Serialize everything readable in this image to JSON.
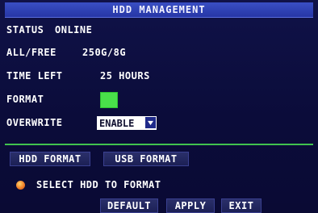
{
  "title": "HDD MANAGEMENT",
  "fields": {
    "status_label": "STATUS",
    "status_value": "ONLINE",
    "capacity_label": "ALL/FREE",
    "capacity_value": "250G/8G",
    "time_left_label": "TIME LEFT",
    "time_left_value": "25 HOURS",
    "format_label": "FORMAT",
    "overwrite_label": "OVERWRITE",
    "overwrite_value": "ENABLE"
  },
  "buttons": {
    "hdd_format": "HDD FORMAT",
    "usb_format": "USB FORMAT",
    "default": "DEFAULT",
    "apply": "APPLY",
    "exit": "EXIT"
  },
  "hint": "SELECT HDD TO FORMAT",
  "colors": {
    "title_bar": "#2a3ab0",
    "format_box": "#49e04a",
    "divider": "#41c34e",
    "hint_dot": "#f07f2a"
  },
  "icons": {
    "dropdown": "chevron-down-icon",
    "hint": "orange-dot-icon"
  }
}
